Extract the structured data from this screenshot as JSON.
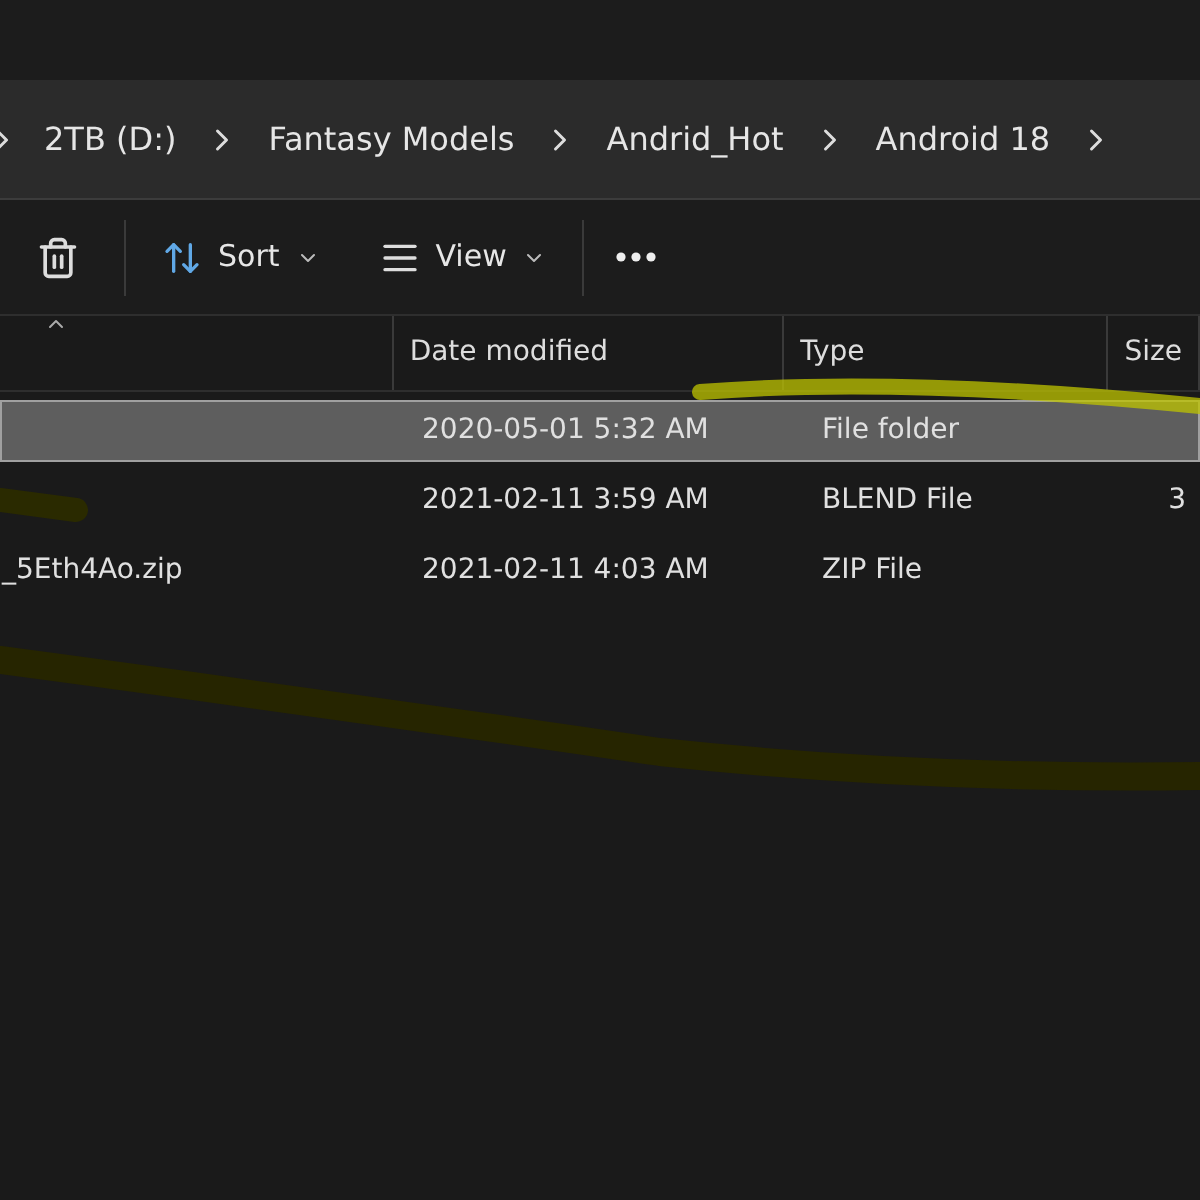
{
  "breadcrumb": [
    "2TB (D:)",
    "Fantasy Models",
    "Andrid_Hot",
    "Android 18"
  ],
  "toolbar": {
    "sort": "Sort",
    "view": "View"
  },
  "table": {
    "columns": [
      "Date modified",
      "Type",
      "Size"
    ],
    "rows": [
      {
        "name": "",
        "date": "2020-05-01 5:32 AM",
        "type": "File folder",
        "size": "",
        "selected": true
      },
      {
        "name": "",
        "date": "2021-02-11 3:59 AM",
        "type": "BLEND File",
        "size": "3",
        "selected": false
      },
      {
        "name": "_5Eth4Ao.zip",
        "date": "2021-02-11 4:03 AM",
        "type": "ZIP File",
        "size": "",
        "selected": false
      }
    ]
  }
}
